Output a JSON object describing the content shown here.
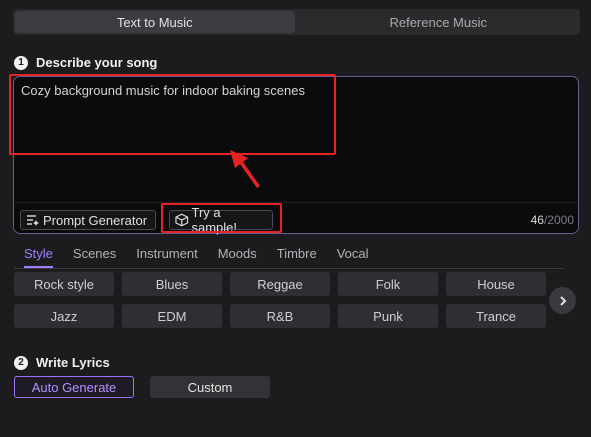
{
  "mode_tabs": [
    {
      "label": "Text to Music",
      "active": true
    },
    {
      "label": "Reference Music",
      "active": false
    }
  ],
  "describe": {
    "step": "1",
    "title": "Describe your song",
    "prompt_text": "Cozy background music for indoor baking scenes",
    "prompt_generator_label": "Prompt Generator",
    "sample_label": "Try a sample!",
    "char_count": "46",
    "char_max": "/2000"
  },
  "categories": [
    "Style",
    "Scenes",
    "Instrument",
    "Moods",
    "Timbre",
    "Vocal"
  ],
  "active_category": "Style",
  "styles": [
    "Rock style",
    "Blues",
    "Reggae",
    "Folk",
    "House",
    "Jazz",
    "EDM",
    "R&B",
    "Punk",
    "Trance"
  ],
  "lyrics": {
    "step": "2",
    "title": "Write Lyrics",
    "auto_label": "Auto Generate",
    "custom_label": "Custom"
  },
  "colors": {
    "accent": "#a27dff",
    "highlight": "#e42424",
    "background": "#1c1c1e"
  }
}
